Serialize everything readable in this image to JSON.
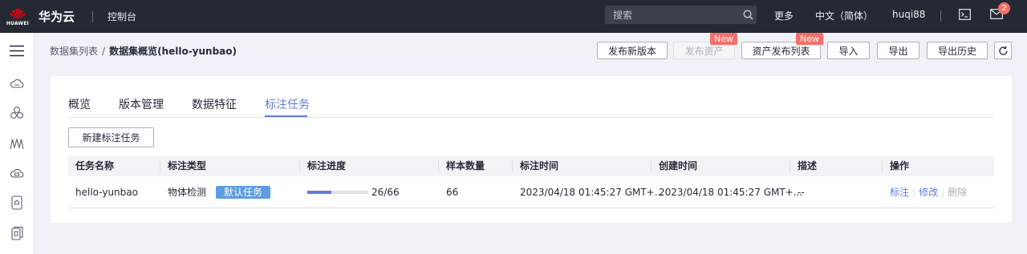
{
  "topbar": {
    "logo_text": "HUAWEI",
    "brand": "华为云",
    "console": "控制台",
    "search_placeholder": "搜索",
    "more": "更多",
    "language": "中文（简体）",
    "username": "huqi88",
    "mail_count": "2"
  },
  "breadcrumb": {
    "parent": "数据集列表",
    "separator": "/",
    "current": "数据集概览(hello-yunbao)"
  },
  "actions": {
    "publish_version": "发布新版本",
    "publish_asset": "发布资产",
    "asset_list": "资产发布列表",
    "import": "导入",
    "export": "导出",
    "export_history": "导出历史",
    "new_tag": "New"
  },
  "tabs": [
    "概览",
    "版本管理",
    "数据特征",
    "标注任务"
  ],
  "active_tab": "标注任务",
  "create_button": "新建标注任务",
  "table": {
    "headers": [
      "任务名称",
      "标注类型",
      "标注进度",
      "样本数量",
      "标注时间",
      "创建时间",
      "描述",
      "操作"
    ],
    "rows": [
      {
        "name": "hello-yunbao",
        "type": "物体检测",
        "tag": "默认任务",
        "progress_text": "26/66",
        "progress_fraction": 0.394,
        "samples": "66",
        "label_time": "2023/04/18 01:45:27 GMT+...",
        "create_time": "2023/04/18 01:45:27 GMT+...",
        "description": "--",
        "ops": [
          "标注",
          "修改",
          "删除"
        ]
      }
    ]
  },
  "colors": {
    "accent": "#5e7ce0",
    "badge": "#f66f6a",
    "topbar": "#252933"
  }
}
